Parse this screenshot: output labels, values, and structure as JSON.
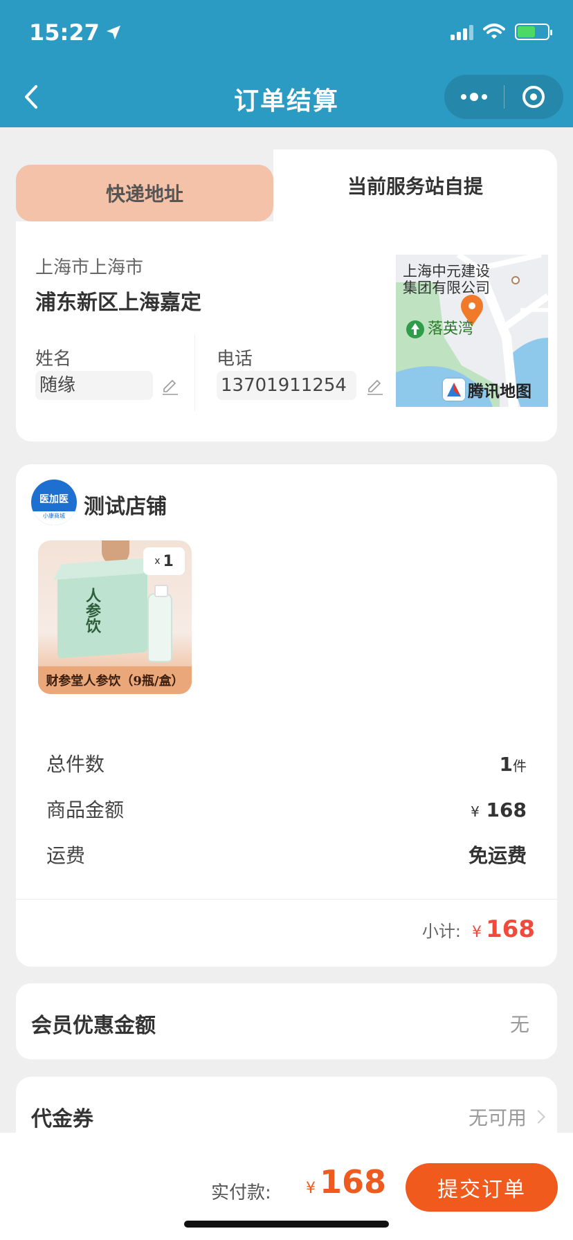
{
  "status_bar": {
    "time": "15:27"
  },
  "nav": {
    "title": "订单结算"
  },
  "address": {
    "tab_express": "快递地址",
    "tab_pickup": "当前服务站自提",
    "city": "上海市上海市",
    "district": "浦东新区上海嘉定",
    "name_label": "姓名",
    "name_value": "随缘",
    "phone_label": "电话",
    "phone_value": "13701911254",
    "map": {
      "poi_line1": "上海中元建设",
      "poi_line2": "集团有限公司",
      "poi_green": "落英湾",
      "provider": "腾讯地图"
    }
  },
  "shop": {
    "logo_text": "医加医",
    "logo_sub": "小康商城",
    "name": "测试店铺",
    "products": [
      {
        "name": "财参堂人参饮（9瓶/盒）",
        "qty_prefix": "x",
        "qty": "1",
        "box_text": "人参饮"
      }
    ],
    "summary": [
      {
        "label": "总件数",
        "value": "1",
        "unit": "件"
      },
      {
        "label": "商品金额",
        "currency": "¥",
        "value": "168"
      },
      {
        "label": "运费",
        "value": "免运费"
      }
    ],
    "subtotal_label": "小计:",
    "subtotal_currency": "¥",
    "subtotal_value": "168"
  },
  "member": {
    "label": "会员优惠金额",
    "value": "无"
  },
  "voucher": {
    "label": "代金券",
    "value": "无可用"
  },
  "footer": {
    "pay_label": "实付款:",
    "currency": "¥",
    "pay_value": "168",
    "submit_label": "提交订单"
  },
  "colors": {
    "header": "#2b9bc3",
    "accent": "#f05a1d",
    "price": "#ef4a3c",
    "tab_active": "#f3c2a8"
  }
}
